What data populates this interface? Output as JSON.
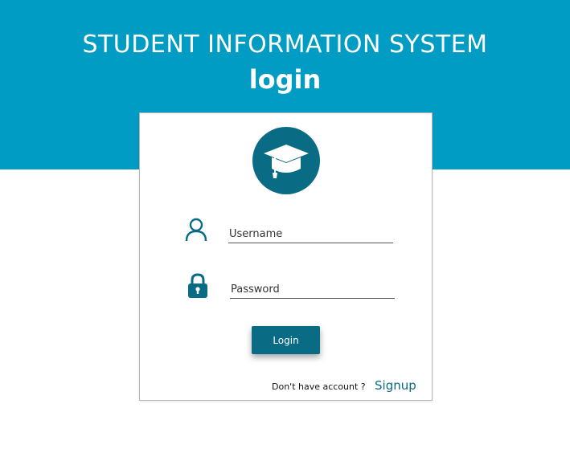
{
  "header": {
    "title": "STUDENT INFORMATION SYSTEM",
    "subtitle": "login"
  },
  "login_form": {
    "logo_icon": "graduation-cap-icon",
    "username_icon": "user-icon",
    "password_icon": "lock-icon",
    "username_placeholder": "Username",
    "password_placeholder": "Password",
    "username_value": "",
    "password_value": "",
    "login_label": "Login",
    "no_account_text": "Don't have account ?",
    "signup_label": "Signup"
  },
  "colors": {
    "banner": "#009cc4",
    "accent": "#0a6b84",
    "background": "#ffffff"
  }
}
